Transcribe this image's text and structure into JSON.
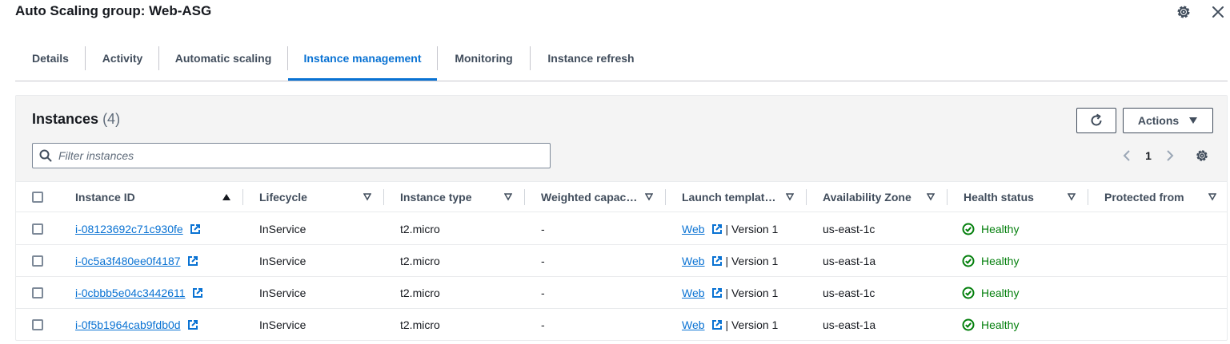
{
  "header": {
    "title": "Auto Scaling group: Web-ASG"
  },
  "tabs": [
    {
      "label": "Details"
    },
    {
      "label": "Activity"
    },
    {
      "label": "Automatic scaling"
    },
    {
      "label": "Instance management"
    },
    {
      "label": "Monitoring"
    },
    {
      "label": "Instance refresh"
    }
  ],
  "panel": {
    "title": "Instances",
    "count": "(4)",
    "actions_label": "Actions",
    "filter_placeholder": "Filter instances",
    "page": "1"
  },
  "columns": [
    {
      "label": "Instance ID"
    },
    {
      "label": "Lifecycle"
    },
    {
      "label": "Instance type"
    },
    {
      "label": "Weighted capac…"
    },
    {
      "label": "Launch templat…"
    },
    {
      "label": "Availability Zone"
    },
    {
      "label": "Health status"
    },
    {
      "label": "Protected from"
    }
  ],
  "rows": [
    {
      "id": "i-08123692c71c930fe",
      "lifecycle": "InService",
      "type": "t2.micro",
      "weight": "-",
      "template": "Web",
      "version": "| Version 1",
      "az": "us-east-1c",
      "health": "Healthy",
      "protected": ""
    },
    {
      "id": "i-0c5a3f480ee0f4187",
      "lifecycle": "InService",
      "type": "t2.micro",
      "weight": "-",
      "template": "Web",
      "version": "| Version 1",
      "az": "us-east-1a",
      "health": "Healthy",
      "protected": ""
    },
    {
      "id": "i-0cbbb5e04c3442611",
      "lifecycle": "InService",
      "type": "t2.micro",
      "weight": "-",
      "template": "Web",
      "version": "| Version 1",
      "az": "us-east-1c",
      "health": "Healthy",
      "protected": ""
    },
    {
      "id": "i-0f5b1964cab9fdb0d",
      "lifecycle": "InService",
      "type": "t2.micro",
      "weight": "-",
      "template": "Web",
      "version": "| Version 1",
      "az": "us-east-1a",
      "health": "Healthy",
      "protected": ""
    }
  ],
  "colors": {
    "link": "#0972d3",
    "healthy": "#037f0c",
    "text": "#16191f"
  }
}
